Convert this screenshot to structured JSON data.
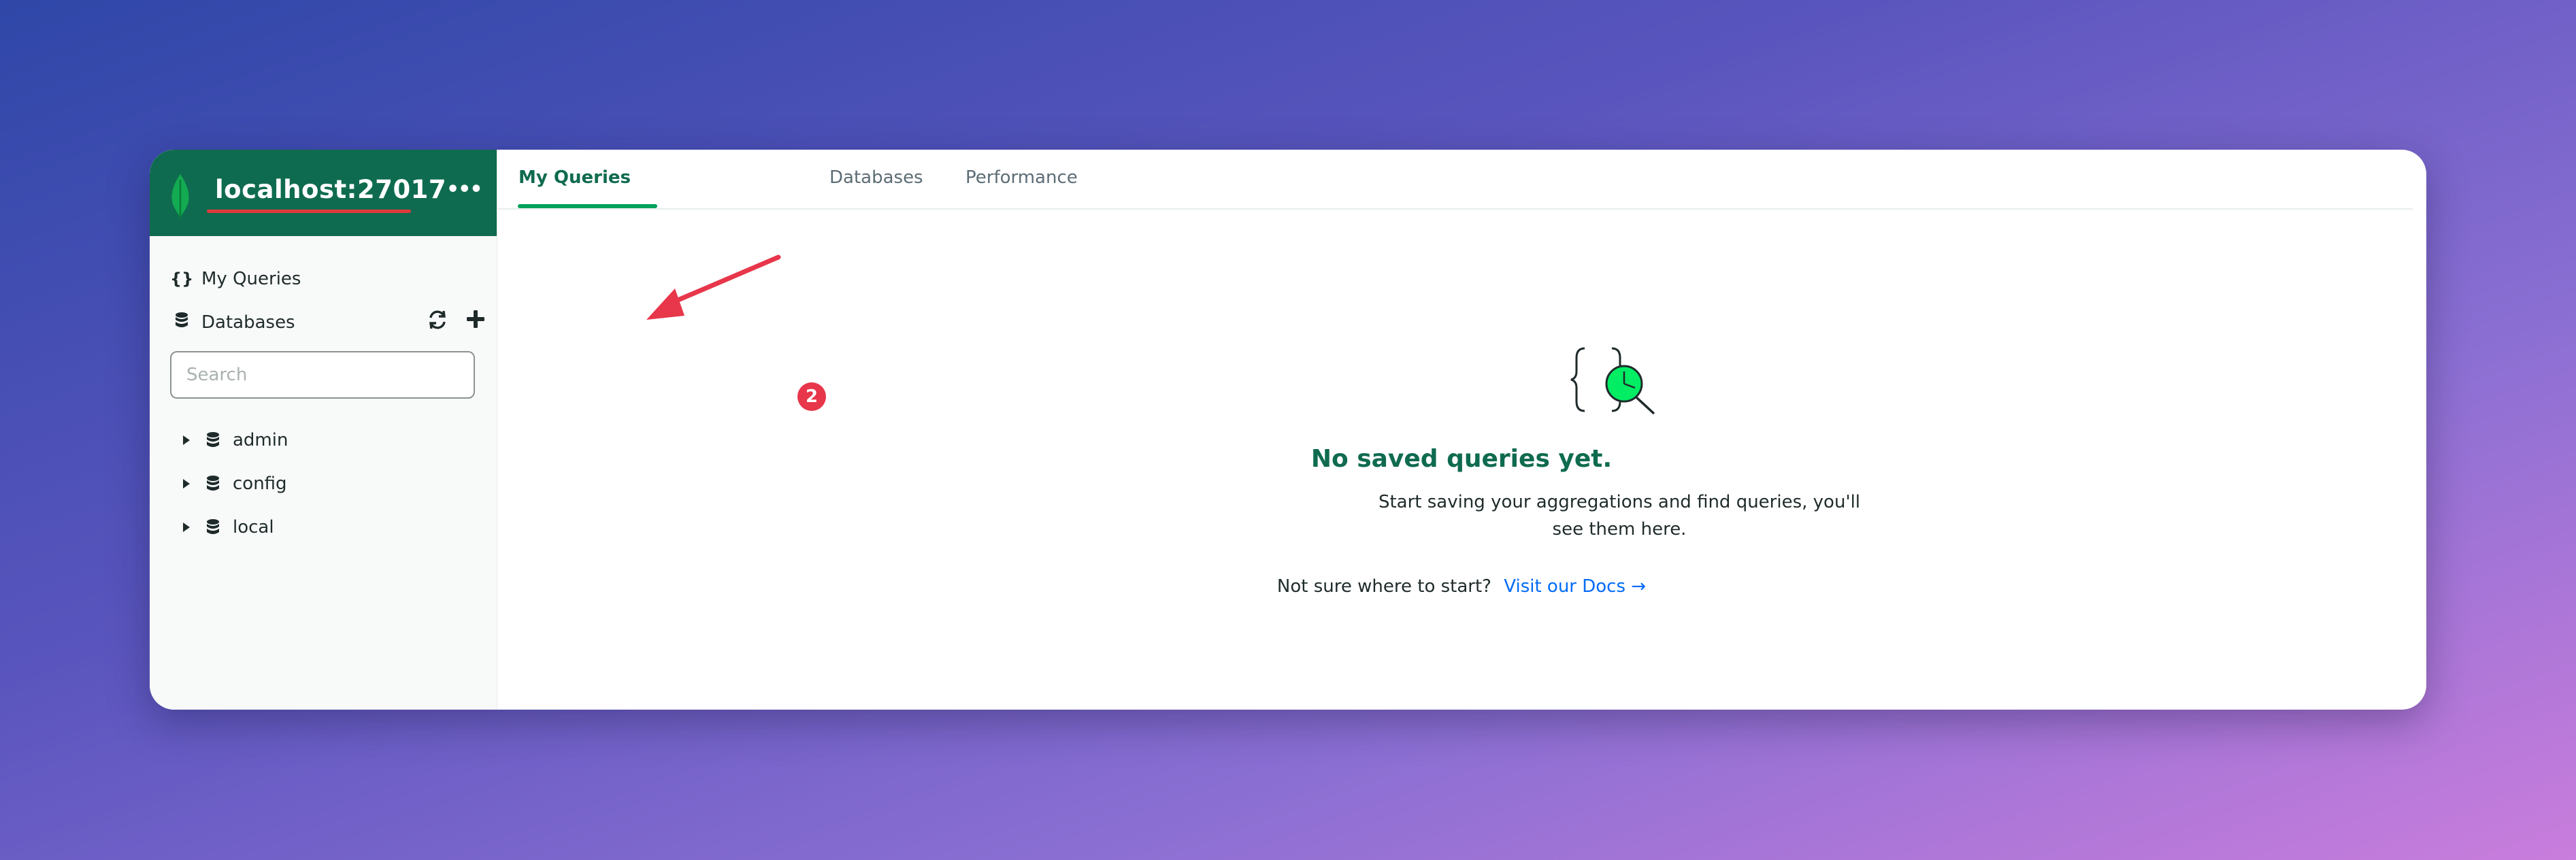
{
  "sidebar": {
    "connection_title": "localhost:27017",
    "more_menu_label": "•••",
    "nav": {
      "my_queries": "My Queries",
      "databases": "Databases"
    },
    "search": {
      "placeholder": "Search",
      "value": ""
    },
    "databases": [
      {
        "name": "admin"
      },
      {
        "name": "config"
      },
      {
        "name": "local"
      }
    ]
  },
  "tabs": [
    {
      "label": "My Queries",
      "active": true
    },
    {
      "label": "Databases",
      "active": false
    },
    {
      "label": "Performance",
      "active": false
    }
  ],
  "empty_state": {
    "title": "No saved queries yet.",
    "description": "Start saving your aggregations and find queries, you'll see them here.",
    "hint_text": "Not sure where to start?",
    "link_text": "Visit our Docs →"
  },
  "annotation": {
    "step_badge": "2"
  },
  "colors": {
    "brand_green": "#0f6b4f",
    "accent_green": "#00a35c",
    "link_blue": "#016bf8",
    "annotation_red": "#e8364a"
  }
}
